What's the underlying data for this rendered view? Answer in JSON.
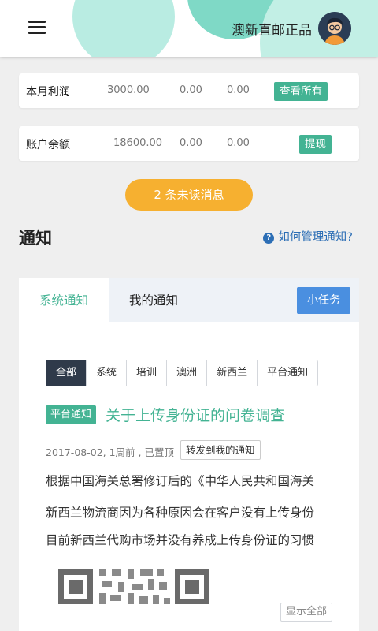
{
  "header": {
    "brand": "澳新直邮正品",
    "menu_icon": "hamburger-menu-icon",
    "avatar_icon": "user-avatar-icon"
  },
  "stats": [
    {
      "label": "本月利润",
      "value1": "3000.00",
      "value2": "0.00",
      "value3": "0.00",
      "button": "查看所有"
    },
    {
      "label": "账户余额",
      "value1": "18600.00",
      "value2": "0.00",
      "value3": "0.00",
      "button": "提现"
    }
  ],
  "unread_button": "2 条未读消息",
  "notice_section": {
    "title": "通知",
    "help_link": "如何管理通知?"
  },
  "panel": {
    "tabs": [
      "系统通知",
      "我的通知"
    ],
    "task_button": "小任务",
    "filters": [
      "全部",
      "系统",
      "培训",
      "澳洲",
      "新西兰",
      "平台通知"
    ],
    "article": {
      "tag": "平台通知",
      "title": "关于上传身份证的问卷调查",
      "meta": "2017-08-02, 1周前 , 已置顶",
      "forward_button": "转发到我的通知",
      "lines": [
        "根据中国海关总署修订后的《中华人民共和国海关",
        "新西兰物流商因为各种原因会在客户没有上传身份",
        "目前新西兰代购市场并没有养成上传身份证的习惯"
      ],
      "show_all": "显示全部"
    }
  },
  "colors": {
    "accent": "#43b393",
    "warning": "#f6b030",
    "primary": "#4a8fe0",
    "dark": "#2f3a4a"
  }
}
